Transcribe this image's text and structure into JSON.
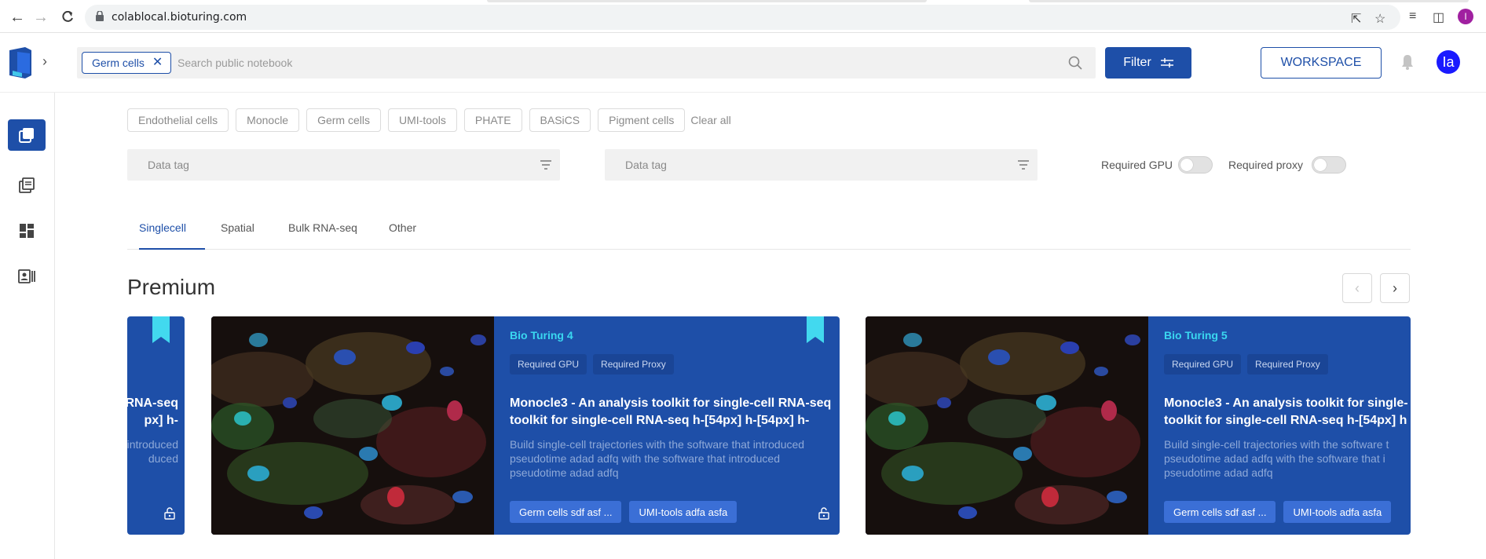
{
  "browser": {
    "url": "colablocal.bioturing.com",
    "profile_initial": "I"
  },
  "header": {
    "active_chip": "Germ cells",
    "search_placeholder": "Search public notebook",
    "filter_label": "Filter",
    "workspace_label": "WORKSPACE",
    "avatar_initials": "Ia"
  },
  "filters": {
    "suggested_tags": [
      "Endothelial cells",
      "Monocle",
      "Germ cells",
      "UMI-tools",
      "PHATE",
      "BASiCS",
      "Pigment cells"
    ],
    "clear_all": "Clear all",
    "select1_placeholder": "Data tag",
    "select2_placeholder": "Data tag",
    "required_gpu_label": "Required GPU",
    "required_proxy_label": "Required proxy"
  },
  "tabs": [
    "Singlecell",
    "Spatial",
    "Bulk RNA-seq",
    "Other"
  ],
  "section": {
    "title": "Premium"
  },
  "cards": [
    {
      "title_line1": "RNA-seq",
      "title_line2": "px] h-",
      "desc_line1": "introduced",
      "desc_line2": "duced"
    },
    {
      "name": "Bio Turing 4",
      "badges": [
        "Required GPU",
        "Required Proxy"
      ],
      "title_line1": "Monocle3 - An analysis toolkit for single-cell RNA-seq",
      "title_line2": "toolkit for single-cell RNA-seq h-[54px] h-[54px] h-",
      "desc": "Build single-cell trajectories with the software that introduced pseudotime adad adfq with the software that introduced pseudotime adad adfq",
      "tags": [
        "Germ cells sdf asf ...",
        "UMI-tools adfa asfa"
      ]
    },
    {
      "name": "Bio Turing 5",
      "badges": [
        "Required GPU",
        "Required Proxy"
      ],
      "title_line1": "Monocle3 - An analysis toolkit for single-",
      "title_line2": "toolkit for single-cell RNA-seq h-[54px] h",
      "desc": "Build single-cell trajectories with the software t pseudotime adad adfq with the software that i pseudotime adad adfq",
      "tags": [
        "Germ cells sdf asf ...",
        "UMI-tools adfa asfa"
      ]
    }
  ],
  "colors": {
    "brand": "#1e4fa8",
    "card_name": "#3ad7f0",
    "bookmark": "#42d9ef"
  }
}
